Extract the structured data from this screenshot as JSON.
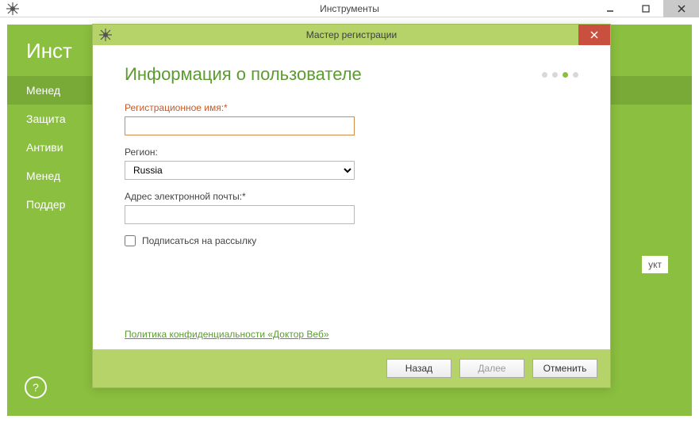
{
  "outer": {
    "title": "Инструменты"
  },
  "main": {
    "title": "Инст",
    "sidebar": [
      "Менед",
      "Защита",
      "Антиви",
      "Менед",
      "Поддер"
    ],
    "right_stub": "укт"
  },
  "dialog": {
    "title": "Мастер регистрации",
    "heading": "Информация о пользователе",
    "step_active": 2,
    "step_count": 4,
    "labels": {
      "reg_name": "Регистрационное имя:*",
      "region": "Регион:",
      "email": "Адрес электронной почты:*",
      "subscribe": "Подписаться на рассылку"
    },
    "values": {
      "reg_name": "",
      "region": "Russia",
      "email": "",
      "subscribe": false
    },
    "privacy_link": "Политика конфиденциальности «Доктор Веб»",
    "buttons": {
      "back": "Назад",
      "next": "Далее",
      "cancel": "Отменить"
    }
  }
}
